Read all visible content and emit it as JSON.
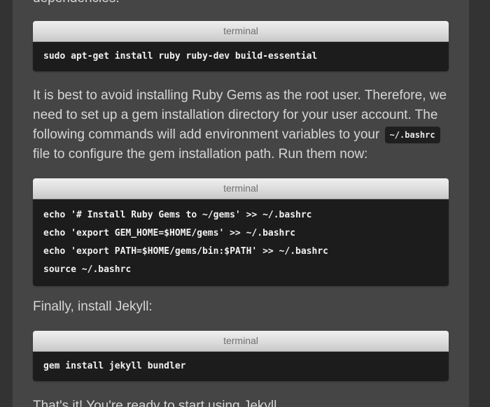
{
  "paragraphs": {
    "top_cut": "dependencies:",
    "intro_part1": "It is best to avoid installing Ruby Gems as the root user. Therefore, we need to set up a gem installation directory for your user account. The following commands will add environment variables to your",
    "intro_code": "~/.bashrc",
    "intro_part2": "file to configure the gem installation path. Run them now:",
    "finally": "Finally, install Jekyll:",
    "bottom_cut": "That's it! You're ready to start using Jekyll."
  },
  "terminals": [
    {
      "title": "terminal",
      "lines": [
        "sudo apt-get install ruby ruby-dev build-essential"
      ]
    },
    {
      "title": "terminal",
      "lines": [
        "echo '# Install Ruby Gems to ~/gems' >> ~/.bashrc",
        "echo 'export GEM_HOME=$HOME/gems' >> ~/.bashrc",
        "echo 'export PATH=$HOME/gems/bin:$PATH' >> ~/.bashrc",
        "source ~/.bashrc"
      ]
    },
    {
      "title": "terminal",
      "lines": [
        "gem install jekyll bundler"
      ]
    }
  ],
  "colors": {
    "page_background": "#333333",
    "content_background": "#454545",
    "body_text": "#d6d6d6",
    "code_background": "#1c1c1c",
    "code_text": "#f1f1f1",
    "terminal_header_text": "#6f6f6f"
  }
}
